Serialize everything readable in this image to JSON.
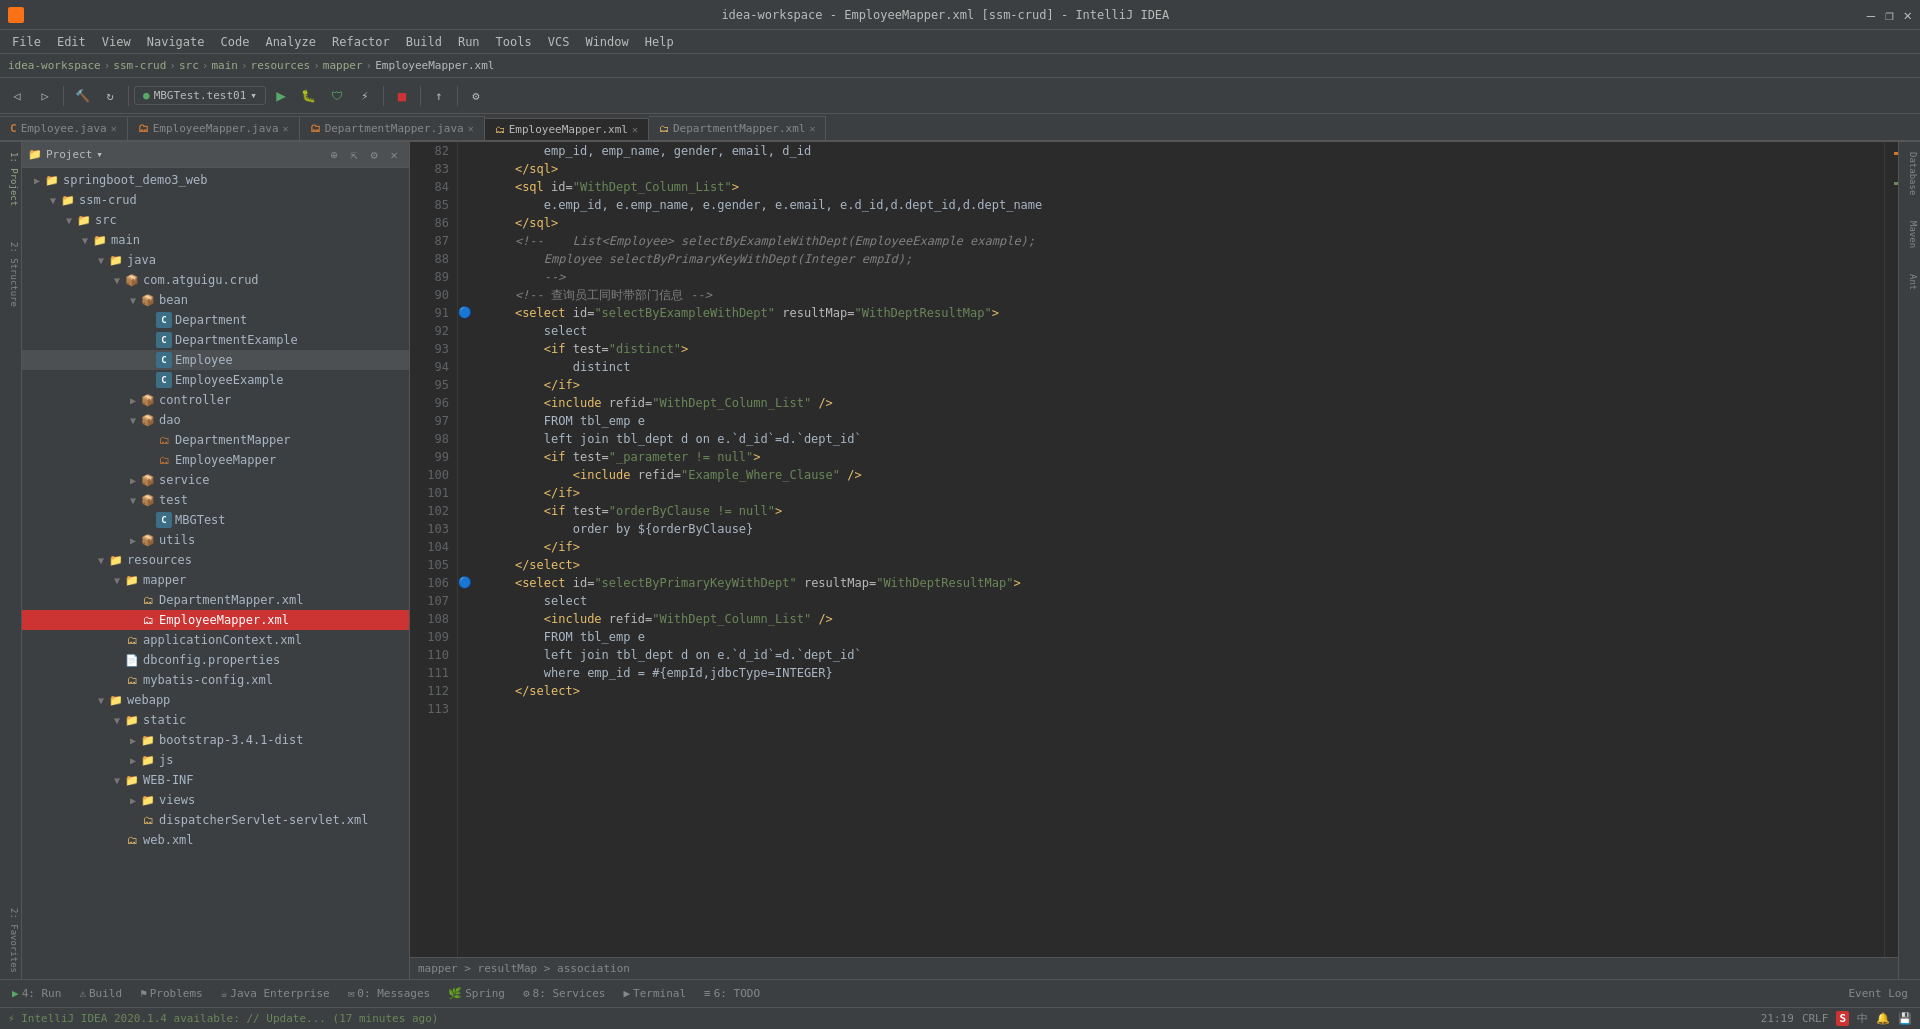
{
  "titlebar": {
    "title": "idea-workspace - EmployeeMapper.xml [ssm-crud] - IntelliJ IDEA",
    "minimize": "—",
    "maximize": "❐",
    "close": "✕"
  },
  "menubar": {
    "items": [
      "File",
      "Edit",
      "View",
      "Navigate",
      "Code",
      "Analyze",
      "Refactor",
      "Build",
      "Run",
      "Tools",
      "VCS",
      "Window",
      "Help"
    ]
  },
  "breadcrumb": {
    "items": [
      "idea-workspace",
      "ssm-crud",
      "src",
      "main",
      "resources",
      "mapper",
      "EmployeeMapper.xml"
    ]
  },
  "run_config": {
    "label": "MBGTest.test01"
  },
  "tabs": [
    {
      "label": "Employee.java",
      "type": "java",
      "active": false,
      "modified": false
    },
    {
      "label": "EmployeeMapper.java",
      "type": "java",
      "active": false,
      "modified": false
    },
    {
      "label": "DepartmentMapper.java",
      "type": "java",
      "active": false,
      "modified": false
    },
    {
      "label": "EmployeeMapper.xml",
      "type": "xml",
      "active": true,
      "modified": false
    },
    {
      "label": "DepartmentMapper.xml",
      "type": "xml",
      "active": false,
      "modified": false
    }
  ],
  "project_tree": {
    "header": "Project",
    "items": [
      {
        "label": "springboot_demo3_web",
        "type": "folder",
        "indent": 1,
        "expanded": true
      },
      {
        "label": "ssm-crud",
        "type": "folder",
        "indent": 2,
        "expanded": true
      },
      {
        "label": "src",
        "type": "folder",
        "indent": 3,
        "expanded": true
      },
      {
        "label": "main",
        "type": "folder",
        "indent": 4,
        "expanded": true
      },
      {
        "label": "java",
        "type": "folder",
        "indent": 5,
        "expanded": true
      },
      {
        "label": "com.atguigu.crud",
        "type": "package",
        "indent": 6,
        "expanded": true
      },
      {
        "label": "bean",
        "type": "folder",
        "indent": 7,
        "expanded": true
      },
      {
        "label": "Department",
        "type": "java",
        "indent": 8
      },
      {
        "label": "DepartmentExample",
        "type": "java",
        "indent": 8
      },
      {
        "label": "Employee",
        "type": "java",
        "indent": 8
      },
      {
        "label": "EmployeeExample",
        "type": "java",
        "indent": 8
      },
      {
        "label": "controller",
        "type": "folder",
        "indent": 7,
        "expanded": false
      },
      {
        "label": "dao",
        "type": "folder",
        "indent": 7,
        "expanded": true
      },
      {
        "label": "DepartmentMapper",
        "type": "mapper",
        "indent": 8
      },
      {
        "label": "EmployeeMapper",
        "type": "mapper",
        "indent": 8
      },
      {
        "label": "service",
        "type": "folder",
        "indent": 7,
        "expanded": false
      },
      {
        "label": "test",
        "type": "folder",
        "indent": 7,
        "expanded": true
      },
      {
        "label": "MBGTest",
        "type": "java",
        "indent": 8
      },
      {
        "label": "utils",
        "type": "folder",
        "indent": 7,
        "expanded": false
      },
      {
        "label": "resources",
        "type": "folder",
        "indent": 5,
        "expanded": true
      },
      {
        "label": "mapper",
        "type": "folder",
        "indent": 6,
        "expanded": true
      },
      {
        "label": "DepartmentMapper.xml",
        "type": "xml",
        "indent": 7
      },
      {
        "label": "EmployeeMapper.xml",
        "type": "xml",
        "indent": 7,
        "active": true
      },
      {
        "label": "applicationContext.xml",
        "type": "xml",
        "indent": 6
      },
      {
        "label": "dbconfig.properties",
        "type": "prop",
        "indent": 6
      },
      {
        "label": "mybatis-config.xml",
        "type": "xml",
        "indent": 6
      },
      {
        "label": "webapp",
        "type": "folder",
        "indent": 5,
        "expanded": true
      },
      {
        "label": "static",
        "type": "folder",
        "indent": 6,
        "expanded": true
      },
      {
        "label": "bootstrap-3.4.1-dist",
        "type": "folder",
        "indent": 7,
        "expanded": false
      },
      {
        "label": "js",
        "type": "folder",
        "indent": 7,
        "expanded": false
      },
      {
        "label": "WEB-INF",
        "type": "folder",
        "indent": 6,
        "expanded": true
      },
      {
        "label": "views",
        "type": "folder",
        "indent": 7,
        "expanded": false
      },
      {
        "label": "dispatcherServlet-servlet.xml",
        "type": "xml",
        "indent": 7
      },
      {
        "label": "web.xml",
        "type": "xml",
        "indent": 6
      }
    ]
  },
  "code_lines": [
    {
      "num": 82,
      "gutter": "",
      "content": "        emp_id, emp_name, gender, email, d_id",
      "type": "plain"
    },
    {
      "num": 83,
      "gutter": "",
      "content": "    </sql>",
      "type": "xml"
    },
    {
      "num": 84,
      "gutter": "",
      "content": "    <sql id=\"WithDept_Column_List\">",
      "type": "xml"
    },
    {
      "num": 85,
      "gutter": "",
      "content": "        e.emp_id, e.emp_name, e.gender, e.email, e.d_id,d.dept_id,d.dept_name",
      "type": "plain"
    },
    {
      "num": 86,
      "gutter": "",
      "content": "    </sql>",
      "type": "xml"
    },
    {
      "num": 87,
      "gutter": "",
      "content": "    <!--    List<Employee> selectByExampleWithDept(EmployeeExample example);",
      "type": "comment"
    },
    {
      "num": 88,
      "gutter": "",
      "content": "        Employee selectByPrimaryKeyWithDept(Integer empId);",
      "type": "comment"
    },
    {
      "num": 89,
      "gutter": "",
      "content": "        -->",
      "type": "comment"
    },
    {
      "num": 90,
      "gutter": "",
      "content": "    <!-- 查询员工同时带部门信息 -->",
      "type": "comment_chinese"
    },
    {
      "num": 91,
      "gutter": "run",
      "content": "    <select id=\"selectByExampleWithDept\" resultMap=\"WithDeptResultMap\">",
      "type": "xml"
    },
    {
      "num": 92,
      "gutter": "",
      "content": "        select",
      "type": "plain"
    },
    {
      "num": 93,
      "gutter": "",
      "content": "        <if test=\"distinct\">",
      "type": "xml"
    },
    {
      "num": 94,
      "gutter": "",
      "content": "            distinct",
      "type": "plain"
    },
    {
      "num": 95,
      "gutter": "",
      "content": "        </if>",
      "type": "xml"
    },
    {
      "num": 96,
      "gutter": "",
      "content": "        <include refid=\"WithDept_Column_List\" />",
      "type": "xml"
    },
    {
      "num": 97,
      "gutter": "",
      "content": "        FROM tbl_emp e",
      "type": "plain"
    },
    {
      "num": 98,
      "gutter": "",
      "content": "        left join tbl_dept d on e.`d_id`=d.`dept_id`",
      "type": "plain"
    },
    {
      "num": 99,
      "gutter": "",
      "content": "        <if test=\"_parameter != null\">",
      "type": "xml"
    },
    {
      "num": 100,
      "gutter": "",
      "content": "            <include refid=\"Example_Where_Clause\" />",
      "type": "xml"
    },
    {
      "num": 101,
      "gutter": "",
      "content": "        </if>",
      "type": "xml"
    },
    {
      "num": 102,
      "gutter": "",
      "content": "        <if test=\"orderByClause != null\">",
      "type": "xml"
    },
    {
      "num": 103,
      "gutter": "",
      "content": "            order by ${orderByClause}",
      "type": "plain"
    },
    {
      "num": 104,
      "gutter": "",
      "content": "        </if>",
      "type": "xml"
    },
    {
      "num": 105,
      "gutter": "",
      "content": "    </select>",
      "type": "xml"
    },
    {
      "num": 106,
      "gutter": "run",
      "content": "    <select id=\"selectByPrimaryKeyWithDept\" resultMap=\"WithDeptResultMap\">",
      "type": "xml"
    },
    {
      "num": 107,
      "gutter": "",
      "content": "        select",
      "type": "plain"
    },
    {
      "num": 108,
      "gutter": "",
      "content": "        <include refid=\"WithDept_Column_List\" />",
      "type": "xml"
    },
    {
      "num": 109,
      "gutter": "",
      "content": "        FROM tbl_emp e",
      "type": "plain"
    },
    {
      "num": 110,
      "gutter": "",
      "content": "        left join tbl_dept d on e.`d_id`=d.`dept_id`",
      "type": "plain"
    },
    {
      "num": 111,
      "gutter": "",
      "content": "        where emp_id = #{empId,jdbcType=INTEGER}",
      "type": "plain"
    },
    {
      "num": 112,
      "gutter": "",
      "content": "    </select>",
      "type": "xml"
    },
    {
      "num": 113,
      "gutter": "",
      "content": "",
      "type": "plain"
    }
  ],
  "code_breadcrumb": {
    "path": "mapper > resultMap > association"
  },
  "bottom_tabs": [
    {
      "label": "▶ 4: Run",
      "active": false
    },
    {
      "label": "⚠ Build",
      "active": false
    },
    {
      "label": "⚑ Problems",
      "active": false
    },
    {
      "label": "☕ Java Enterprise",
      "active": false
    },
    {
      "label": "✉ 0: Messages",
      "active": false
    },
    {
      "label": "🌿 Spring",
      "active": false
    },
    {
      "label": "⚙ 8: Services",
      "active": false
    },
    {
      "label": "▶ Terminal",
      "active": false
    },
    {
      "label": "≡ 6: TODO",
      "active": false
    }
  ],
  "statusbar": {
    "message": "IntelliJ IDEA 2020.1.4 available: // Update... (17 minutes ago)",
    "position": "21:19",
    "encoding": "CRLF",
    "file_type": "S",
    "lang": "中",
    "memory": ""
  }
}
